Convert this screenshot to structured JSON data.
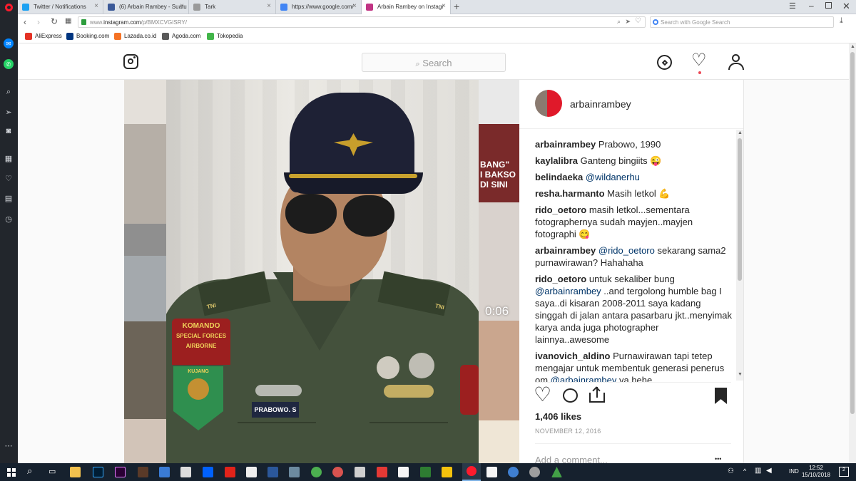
{
  "browser": {
    "tabs": [
      {
        "label": "Twitter / Notifications",
        "color": "#1da1f2"
      },
      {
        "label": "(6) Arbain Rambey - Suatu",
        "color": "#3b5998"
      },
      {
        "label": "Tark",
        "color": "#888888"
      },
      {
        "label": "https://www.google.com/",
        "color": "#4285f4"
      },
      {
        "label": "Arbain Rambey on Instagr",
        "color": "#c13584"
      }
    ],
    "url_prefix": "www.",
    "url_domain": "instagram.com",
    "url_path": "/p/BMXCVGISRY/",
    "search_placeholder": "Search with Google Search",
    "bookmarks": [
      {
        "label": "AliExpress",
        "color": "#e43225"
      },
      {
        "label": "Booking.com",
        "color": "#003580"
      },
      {
        "label": "Lazada.co.id",
        "color": "#f57224"
      },
      {
        "label": "Agoda.com",
        "color": "#5a5a5a"
      },
      {
        "label": "Tokopedia",
        "color": "#42b549"
      }
    ]
  },
  "instagram": {
    "search_placeholder": "Search",
    "username": "arbainrambey",
    "video_time": "0:06",
    "comments": [
      {
        "user": "arbainrambey",
        "text": "Prabowo, 1990"
      },
      {
        "user": "kaylalibra",
        "text": "Ganteng bingiits 😜"
      },
      {
        "user": "belindaeka",
        "text": "@wildanerhu",
        "link": true
      },
      {
        "user": "resha.harmanto",
        "text": "Masih letkol 💪"
      },
      {
        "user": "rido_oetoro",
        "text": "masih letkol...sementara fotographernya sudah mayjen..mayjen fotographi 😋"
      },
      {
        "user": "arbainrambey",
        "mention": "@rido_oetoro",
        "text": " sekarang sama2 purnawirawan? Hahahaha"
      },
      {
        "user": "rido_oetoro",
        "text": "untuk sekaliber bung ",
        "mention": "@arbainrambey",
        "text2": " ..and tergolong humble bag I saya..di kisaran 2008-2011 saya kadang singgah di jalan antara pasarbaru jkt..menyimak karya anda juga photographer lainnya..awesome"
      },
      {
        "user": "ivanovich_aldino",
        "text": "Purnawirawan tapi tetep mengajar untuk membentuk generasi penerus om ",
        "mention": "@arbainrambey",
        "text2": " ya hehe"
      }
    ],
    "likes": "1,406 likes",
    "date": "NOVEMBER 12, 2016",
    "add_comment_placeholder": "Add a comment...",
    "more_label": "•••"
  },
  "photo": {
    "name_tag": "PRABOWO. S",
    "shoulder_left": "TNI",
    "shoulder_right": "TNI",
    "patch_line1": "KOMANDO",
    "patch_line2": "SPECIAL FORCES",
    "patch_line3": "AIRBORNE",
    "patch_line4": "KUJANG",
    "thumb_text1": "BANG\"",
    "thumb_text2": "I BAKSO",
    "thumb_text3": "DI SINI"
  },
  "taskbar": {
    "lang": "IND",
    "time": "12:52",
    "date": "15/10/2018",
    "notif": "2"
  }
}
